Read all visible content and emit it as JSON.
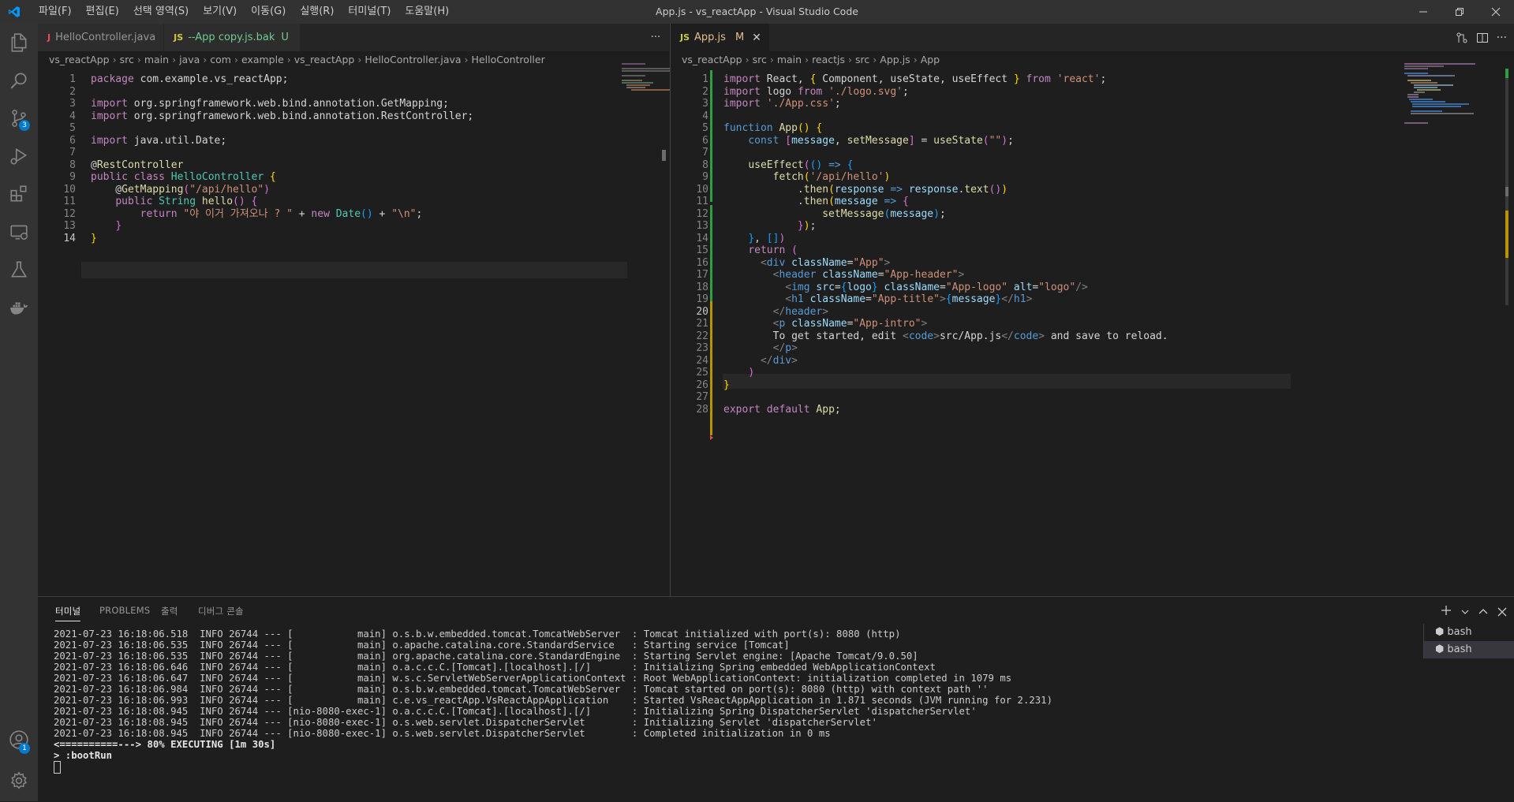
{
  "window": {
    "title": "App.js - vs_reactApp - Visual Studio Code",
    "menu": [
      "파일(F)",
      "편집(E)",
      "선택 영역(S)",
      "보기(V)",
      "이동(G)",
      "실행(R)",
      "터미널(T)",
      "도움말(H)"
    ]
  },
  "activity_bar": {
    "scm_badge": "3",
    "accounts_badge": "1"
  },
  "left_editor": {
    "tabs": [
      {
        "label": "HelloController.java",
        "icon": "J",
        "suffix": ""
      },
      {
        "label": "--App copy.js.bak",
        "icon": "JS",
        "suffix": "U"
      }
    ],
    "more": "···",
    "breadcrumb": [
      "vs_reactApp",
      "src",
      "main",
      "java",
      "com",
      "example",
      "vs_reactApp",
      "HelloController.java",
      "HelloController"
    ],
    "line_numbers": [
      "1",
      "2",
      "3",
      "4",
      "5",
      "6",
      "7",
      "8",
      "9",
      "10",
      "11",
      "12",
      "13",
      "14"
    ],
    "lines": [
      [
        [
          "kw",
          "package"
        ],
        [
          "pl",
          " com.example.vs_reactApp;"
        ]
      ],
      [],
      [
        [
          "kw",
          "import"
        ],
        [
          "pl",
          " org.springframework.web.bind.annotation.GetMapping;"
        ]
      ],
      [
        [
          "kw",
          "import"
        ],
        [
          "pl",
          " org.springframework.web.bind.annotation.RestController;"
        ]
      ],
      [],
      [
        [
          "kw",
          "import"
        ],
        [
          "pl",
          " java.util.Date;"
        ]
      ],
      [],
      [
        [
          "pl",
          "@"
        ],
        [
          "ann",
          "RestController"
        ]
      ],
      [
        [
          "kw",
          "public"
        ],
        [
          "pl",
          " "
        ],
        [
          "kw",
          "class"
        ],
        [
          "pl",
          " "
        ],
        [
          "ty",
          "HelloController"
        ],
        [
          "pl",
          " "
        ],
        [
          "br1",
          "{"
        ]
      ],
      [
        [
          "pl",
          "    @"
        ],
        [
          "ann",
          "GetMapping"
        ],
        [
          "br2",
          "("
        ],
        [
          "str",
          "\"/api/hello\""
        ],
        [
          "br2",
          ")"
        ]
      ],
      [
        [
          "pl",
          "    "
        ],
        [
          "kw",
          "public"
        ],
        [
          "pl",
          " "
        ],
        [
          "ty",
          "String"
        ],
        [
          "pl",
          " "
        ],
        [
          "fn",
          "hello"
        ],
        [
          "br2",
          "()"
        ],
        [
          "pl",
          " "
        ],
        [
          "br2",
          "{"
        ]
      ],
      [
        [
          "pl",
          "        "
        ],
        [
          "kw",
          "return"
        ],
        [
          "pl",
          " "
        ],
        [
          "str",
          "\"야 이거 가져오나 ? \""
        ],
        [
          "pl",
          " + "
        ],
        [
          "kw",
          "new"
        ],
        [
          "pl",
          " "
        ],
        [
          "ty",
          "Date"
        ],
        [
          "br3",
          "()"
        ],
        [
          "pl",
          " + "
        ],
        [
          "str",
          "\"\\n\""
        ],
        [
          "pl",
          ";"
        ]
      ],
      [
        [
          "pl",
          "    "
        ],
        [
          "br2",
          "}"
        ]
      ],
      [
        [
          "br1",
          "}"
        ]
      ]
    ]
  },
  "right_editor": {
    "tabs": [
      {
        "label": "App.js",
        "icon": "JS",
        "suffix": "M"
      }
    ],
    "breadcrumb": [
      "vs_reactApp",
      "src",
      "main",
      "reactjs",
      "src",
      "App.js",
      "App"
    ],
    "line_numbers": [
      "1",
      "2",
      "3",
      "4",
      "5",
      "6",
      "7",
      "8",
      "9",
      "10",
      "11",
      "12",
      "13",
      "14",
      "15",
      "16",
      "17",
      "18",
      "19",
      "20",
      "21",
      "22",
      "23",
      "24",
      "25",
      "26",
      "27",
      "28"
    ],
    "lines": [
      [
        [
          "kw",
          "import"
        ],
        [
          "pl",
          " React, "
        ],
        [
          "br1",
          "{"
        ],
        [
          "pl",
          " Component, useState, useEffect "
        ],
        [
          "br1",
          "}"
        ],
        [
          "pl",
          " "
        ],
        [
          "kw",
          "from"
        ],
        [
          "pl",
          " "
        ],
        [
          "str",
          "'react'"
        ],
        [
          "pl",
          ";"
        ]
      ],
      [
        [
          "kw",
          "import"
        ],
        [
          "pl",
          " logo "
        ],
        [
          "kw",
          "from"
        ],
        [
          "pl",
          " "
        ],
        [
          "str",
          "'./logo.svg'"
        ],
        [
          "pl",
          ";"
        ]
      ],
      [
        [
          "kw",
          "import"
        ],
        [
          "pl",
          " "
        ],
        [
          "str",
          "'./App.css'"
        ],
        [
          "pl",
          ";"
        ]
      ],
      [],
      [
        [
          "kw2",
          "function"
        ],
        [
          "pl",
          " "
        ],
        [
          "fn",
          "App"
        ],
        [
          "br1",
          "()"
        ],
        [
          "pl",
          " "
        ],
        [
          "br1",
          "{"
        ]
      ],
      [
        [
          "pl",
          "    "
        ],
        [
          "kw2",
          "const"
        ],
        [
          "pl",
          " "
        ],
        [
          "br2",
          "["
        ],
        [
          "var",
          "message"
        ],
        [
          "pl",
          ", "
        ],
        [
          "fn",
          "setMessage"
        ],
        [
          "br2",
          "]"
        ],
        [
          "pl",
          " = "
        ],
        [
          "fn",
          "useState"
        ],
        [
          "br2",
          "("
        ],
        [
          "str",
          "\"\""
        ],
        [
          "br2",
          ")"
        ],
        [
          "pl",
          ";"
        ]
      ],
      [],
      [
        [
          "pl",
          "    "
        ],
        [
          "fn",
          "useEffect"
        ],
        [
          "br2",
          "("
        ],
        [
          "br3",
          "()"
        ],
        [
          "pl",
          " "
        ],
        [
          "kw2",
          "=>"
        ],
        [
          "pl",
          " "
        ],
        [
          "br3",
          "{"
        ]
      ],
      [
        [
          "pl",
          "        "
        ],
        [
          "fn",
          "fetch"
        ],
        [
          "br1",
          "("
        ],
        [
          "str",
          "'/api/hello'"
        ],
        [
          "br1",
          ")"
        ]
      ],
      [
        [
          "pl",
          "            ."
        ],
        [
          "fn",
          "then"
        ],
        [
          "br1",
          "("
        ],
        [
          "var",
          "response"
        ],
        [
          "pl",
          " "
        ],
        [
          "kw2",
          "=>"
        ],
        [
          "pl",
          " "
        ],
        [
          "var",
          "response"
        ],
        [
          "pl",
          "."
        ],
        [
          "fn",
          "text"
        ],
        [
          "br2",
          "()"
        ],
        [
          "br1",
          ")"
        ]
      ],
      [
        [
          "pl",
          "            ."
        ],
        [
          "fn",
          "then"
        ],
        [
          "br1",
          "("
        ],
        [
          "var",
          "message"
        ],
        [
          "pl",
          " "
        ],
        [
          "kw2",
          "=>"
        ],
        [
          "pl",
          " "
        ],
        [
          "br2",
          "{"
        ]
      ],
      [
        [
          "pl",
          "                "
        ],
        [
          "fn",
          "setMessage"
        ],
        [
          "br3",
          "("
        ],
        [
          "var",
          "message"
        ],
        [
          "br3",
          ")"
        ],
        [
          "pl",
          ";"
        ]
      ],
      [
        [
          "pl",
          "            "
        ],
        [
          "br2",
          "}"
        ],
        [
          "br1",
          ")"
        ],
        [
          "pl",
          ";"
        ]
      ],
      [
        [
          "pl",
          "    "
        ],
        [
          "br3",
          "}"
        ],
        [
          "pl",
          ", "
        ],
        [
          "br3",
          "[]"
        ],
        [
          "br2",
          ")"
        ]
      ],
      [
        [
          "pl",
          "    "
        ],
        [
          "kw",
          "return"
        ],
        [
          "pl",
          " "
        ],
        [
          "br2",
          "("
        ]
      ],
      [
        [
          "pl",
          "      "
        ],
        [
          "dim",
          "<"
        ],
        [
          "tag",
          "div"
        ],
        [
          "pl",
          " "
        ],
        [
          "attr",
          "className"
        ],
        [
          "pl",
          "="
        ],
        [
          "str",
          "\"App\""
        ],
        [
          "dim",
          ">"
        ]
      ],
      [
        [
          "pl",
          "        "
        ],
        [
          "dim",
          "<"
        ],
        [
          "tag",
          "header"
        ],
        [
          "pl",
          " "
        ],
        [
          "attr",
          "className"
        ],
        [
          "pl",
          "="
        ],
        [
          "str",
          "\"App-header\""
        ],
        [
          "dim",
          ">"
        ]
      ],
      [
        [
          "pl",
          "          "
        ],
        [
          "dim",
          "<"
        ],
        [
          "tag",
          "img"
        ],
        [
          "pl",
          " "
        ],
        [
          "attr",
          "src"
        ],
        [
          "pl",
          "="
        ],
        [
          "br3",
          "{"
        ],
        [
          "var",
          "logo"
        ],
        [
          "br3",
          "}"
        ],
        [
          "pl",
          " "
        ],
        [
          "attr",
          "className"
        ],
        [
          "pl",
          "="
        ],
        [
          "str",
          "\"App-logo\""
        ],
        [
          "pl",
          " "
        ],
        [
          "attr",
          "alt"
        ],
        [
          "pl",
          "="
        ],
        [
          "str",
          "\"logo\""
        ],
        [
          "dim",
          "/>"
        ]
      ],
      [
        [
          "pl",
          "          "
        ],
        [
          "dim",
          "<"
        ],
        [
          "tag",
          "h1"
        ],
        [
          "pl",
          " "
        ],
        [
          "attr",
          "className"
        ],
        [
          "pl",
          "="
        ],
        [
          "str",
          "\"App-title\""
        ],
        [
          "dim",
          ">"
        ],
        [
          "br3",
          "{"
        ],
        [
          "var",
          "message"
        ],
        [
          "br3",
          "}"
        ],
        [
          "dim",
          "</"
        ],
        [
          "tag",
          "h1"
        ],
        [
          "dim",
          ">"
        ]
      ],
      [
        [
          "pl",
          "        "
        ],
        [
          "dim",
          "</"
        ],
        [
          "tag",
          "header"
        ],
        [
          "dim",
          ">"
        ]
      ],
      [
        [
          "pl",
          "        "
        ],
        [
          "dim",
          "<"
        ],
        [
          "tag",
          "p"
        ],
        [
          "pl",
          " "
        ],
        [
          "attr",
          "className"
        ],
        [
          "pl",
          "="
        ],
        [
          "str",
          "\"App-intro\""
        ],
        [
          "dim",
          ">"
        ]
      ],
      [
        [
          "pl",
          "        To get started, edit "
        ],
        [
          "dim",
          "<"
        ],
        [
          "tag",
          "code"
        ],
        [
          "dim",
          ">"
        ],
        [
          "pl",
          "src/App.js"
        ],
        [
          "dim",
          "</"
        ],
        [
          "tag",
          "code"
        ],
        [
          "dim",
          ">"
        ],
        [
          "pl",
          " and save to reload."
        ]
      ],
      [
        [
          "pl",
          "        "
        ],
        [
          "dim",
          "</"
        ],
        [
          "tag",
          "p"
        ],
        [
          "dim",
          ">"
        ]
      ],
      [
        [
          "pl",
          "      "
        ],
        [
          "dim",
          "</"
        ],
        [
          "tag",
          "div"
        ],
        [
          "dim",
          ">"
        ]
      ],
      [
        [
          "pl",
          "    "
        ],
        [
          "br2",
          ")"
        ]
      ],
      [
        [
          "br1",
          "}"
        ]
      ],
      [],
      [
        [
          "kw",
          "export"
        ],
        [
          "pl",
          " "
        ],
        [
          "kw",
          "default"
        ],
        [
          "pl",
          " "
        ],
        [
          "fn",
          "App"
        ],
        [
          "pl",
          ";"
        ]
      ]
    ]
  },
  "panel": {
    "tabs": [
      "터미널",
      "PROBLEMS",
      "출력",
      "디버그 콘솔"
    ],
    "terminal_lines": [
      "2021-07-23 16:18:06.518  INFO 26744 --- [           main] o.s.b.w.embedded.tomcat.TomcatWebServer  : Tomcat initialized with port(s): 8080 (http)",
      "2021-07-23 16:18:06.535  INFO 26744 --- [           main] o.apache.catalina.core.StandardService   : Starting service [Tomcat]",
      "2021-07-23 16:18:06.535  INFO 26744 --- [           main] org.apache.catalina.core.StandardEngine  : Starting Servlet engine: [Apache Tomcat/9.0.50]",
      "2021-07-23 16:18:06.646  INFO 26744 --- [           main] o.a.c.c.C.[Tomcat].[localhost].[/]       : Initializing Spring embedded WebApplicationContext",
      "2021-07-23 16:18:06.647  INFO 26744 --- [           main] w.s.c.ServletWebServerApplicationContext : Root WebApplicationContext: initialization completed in 1079 ms",
      "2021-07-23 16:18:06.984  INFO 26744 --- [           main] o.s.b.w.embedded.tomcat.TomcatWebServer  : Tomcat started on port(s): 8080 (http) with context path ''",
      "2021-07-23 16:18:06.993  INFO 26744 --- [           main] c.e.vs_reactApp.VsReactAppApplication    : Started VsReactAppApplication in 1.871 seconds (JVM running for 2.231)",
      "2021-07-23 16:18:08.945  INFO 26744 --- [nio-8080-exec-1] o.a.c.c.C.[Tomcat].[localhost].[/]       : Initializing Spring DispatcherServlet 'dispatcherServlet'",
      "2021-07-23 16:18:08.945  INFO 26744 --- [nio-8080-exec-1] o.s.web.servlet.DispatcherServlet        : Initializing Servlet 'dispatcherServlet'",
      "2021-07-23 16:18:08.945  INFO 26744 --- [nio-8080-exec-1] o.s.web.servlet.DispatcherServlet        : Completed initialization in 0 ms"
    ],
    "progress_line": "<==========---> 80% EXECUTING [1m 30s]",
    "task_line": "> :bootRun",
    "terminal_sessions": [
      "bash",
      "bash"
    ]
  },
  "colors": {
    "accent": "#007acc",
    "java_icon": "#f14c4c",
    "js_icon": "#cbcb41",
    "modified": "#e2c08d",
    "untracked": "#73c991"
  }
}
